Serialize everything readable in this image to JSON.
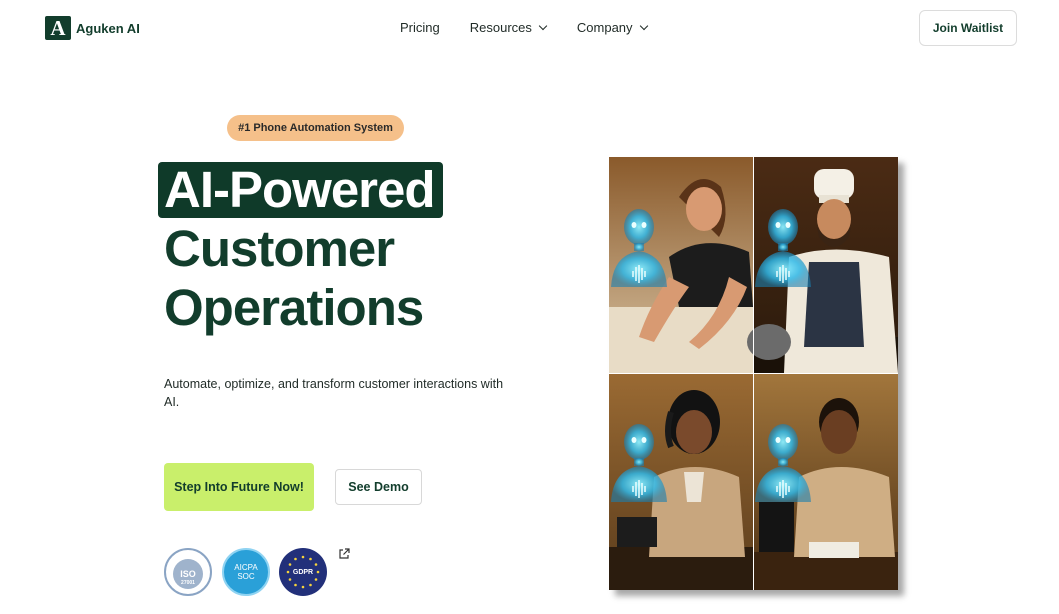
{
  "header": {
    "logo_mark": "A",
    "logo_text": "Aguken AI",
    "nav": [
      {
        "label": "Pricing"
      },
      {
        "label": "Resources"
      },
      {
        "label": "Company"
      }
    ],
    "join_label": "Join Waitlist"
  },
  "hero": {
    "badge": "#1 Phone Automation System",
    "headline": [
      "AI-Powered",
      "Customer",
      "Operations"
    ],
    "subtitle": "Automate, optimize, and transform customer interactions with AI.",
    "cta_label": "Step Into Future Now!",
    "demo_label": "See Demo"
  },
  "certifications": {
    "iso": "ISO",
    "iso_code": "27001",
    "aicpa_line1": "AICPA",
    "aicpa_line2": "SOC",
    "gdpr": "GDPR"
  },
  "colors": {
    "brand": "#123d2c",
    "cta": "#c9ef6b",
    "badge": "#f5c08a"
  }
}
